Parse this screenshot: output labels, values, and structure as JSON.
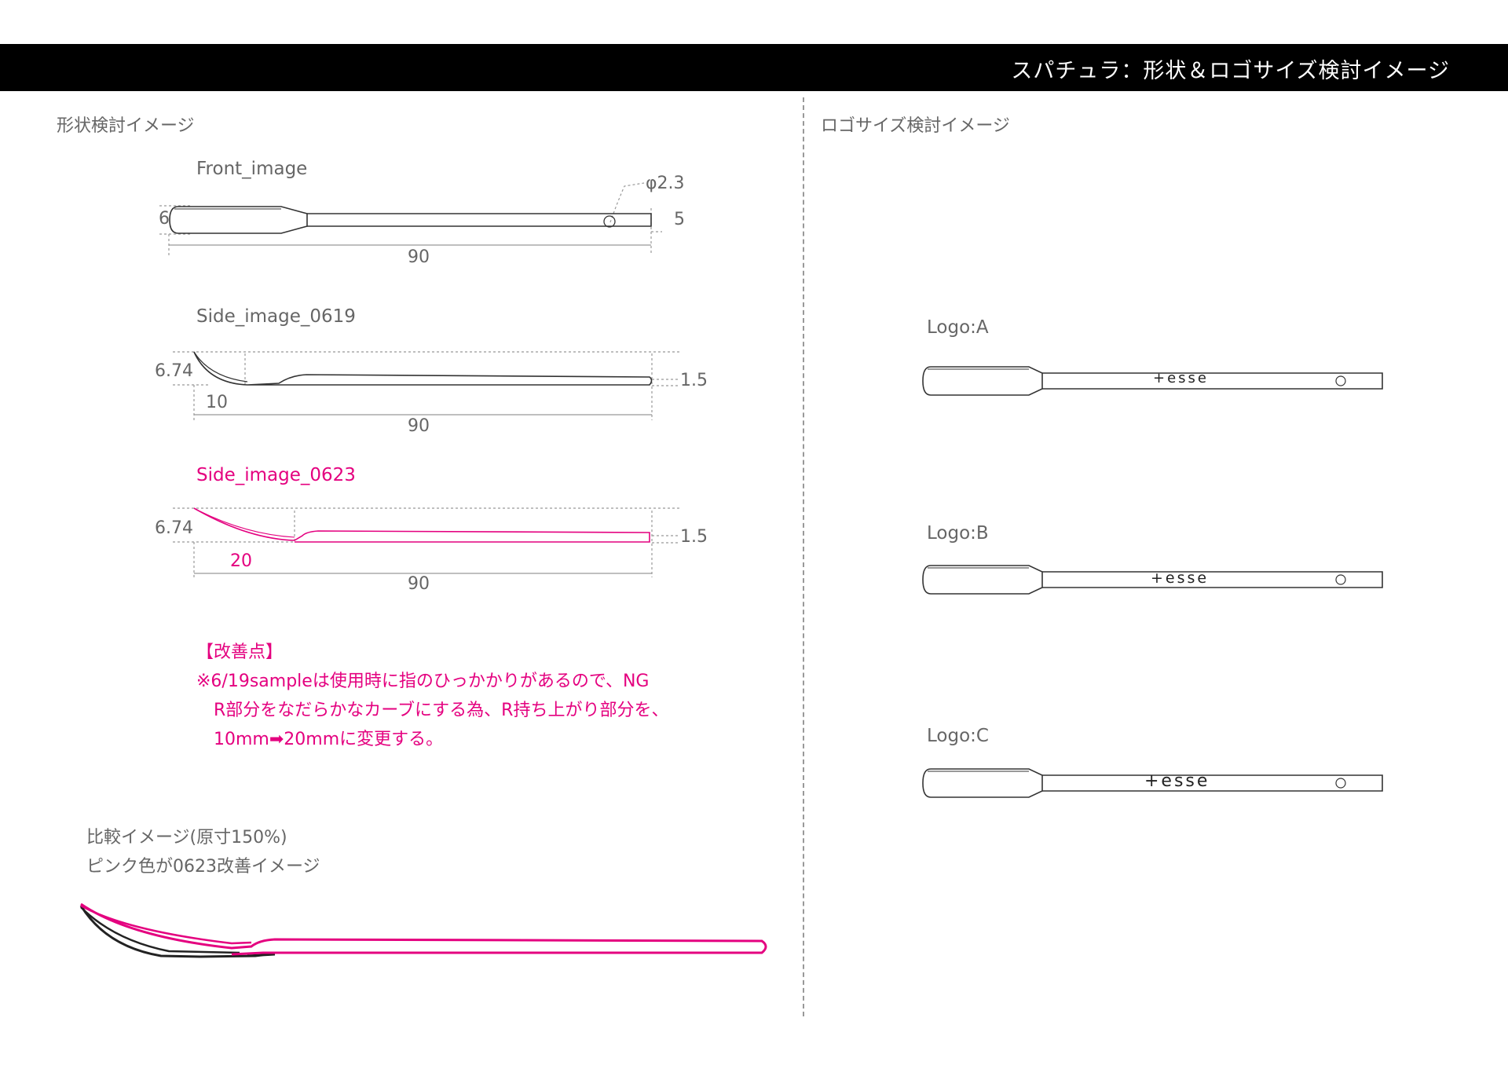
{
  "header": {
    "title": "スパチュラ：形状＆ロゴサイズ検討イメージ"
  },
  "left": {
    "section_title": "形状検討イメージ",
    "front": {
      "label": "Front_image",
      "dim_height_left": "6",
      "dim_height_right": "5",
      "dim_length": "90",
      "dim_hole": "φ2.3"
    },
    "side_0619": {
      "label": "Side_image_0619",
      "dim_height": "6.74",
      "dim_thickness": "1.5",
      "dim_curve": "10",
      "dim_length": "90"
    },
    "side_0623": {
      "label": "Side_image_0623",
      "dim_height": "6.74",
      "dim_thickness": "1.5",
      "dim_curve": "20",
      "dim_length": "90"
    },
    "improvement": {
      "heading": "【改善点】",
      "line1": "※6/19sampleは使用時に指のひっかかりがあるので、NG",
      "line2": "R部分をなだらかなカーブにする為、R持ち上がり部分を、",
      "line3": "10mm➡20mmに変更する。"
    },
    "comparison": {
      "line1": "比較イメージ(原寸150%)",
      "line2": "ピンク色が0623改善イメージ"
    }
  },
  "right": {
    "section_title": "ロゴサイズ検討イメージ",
    "logos": [
      {
        "label": "Logo:A",
        "text": "+esse"
      },
      {
        "label": "Logo:B",
        "text": "+esse"
      },
      {
        "label": "Logo:C",
        "text": "+esse"
      }
    ]
  },
  "colors": {
    "accent_pink": "#e4007f",
    "outline": "#333333",
    "header_bg": "#000000",
    "dimension_line": "#999999"
  }
}
